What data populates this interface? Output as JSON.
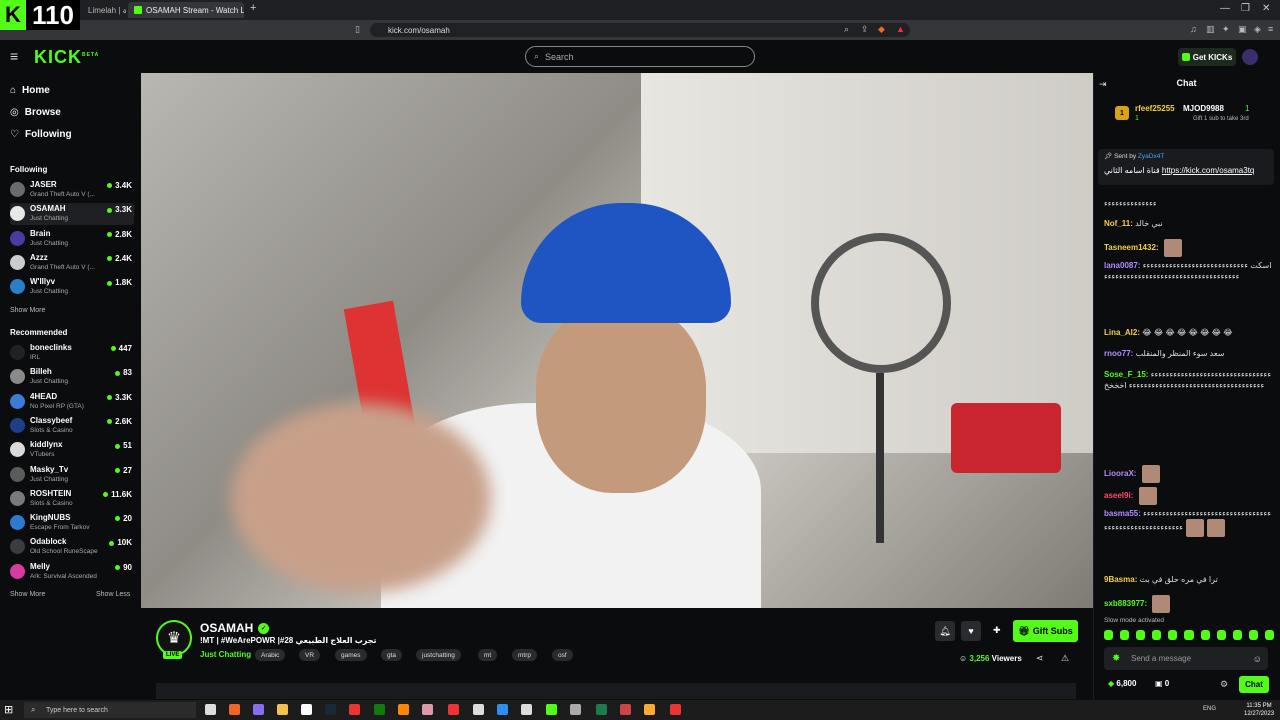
{
  "browser": {
    "counter_badge": "110",
    "tabs": [
      {
        "label": "Limelah | جولة"
      },
      {
        "label": "OSAMAH Stream - Watch Liv"
      }
    ],
    "url": "kick.com/osamah"
  },
  "header": {
    "logo": "KICK",
    "logo_beta": "BETA",
    "search_placeholder": "Search",
    "get_kicks_label": "Get KICKs"
  },
  "sidebar": {
    "nav": [
      {
        "label": "Home",
        "icon": "home-icon"
      },
      {
        "label": "Browse",
        "icon": "compass-icon"
      },
      {
        "label": "Following",
        "icon": "heart-icon"
      }
    ],
    "following_title": "Following",
    "following": [
      {
        "name": "JASER",
        "category": "Grand Theft Auto V (...",
        "viewers": "3.4K",
        "color": "#6b6b6b"
      },
      {
        "name": "OSAMAH",
        "category": "Just Chatting",
        "viewers": "3.3K",
        "color": "#e8e8e8"
      },
      {
        "name": "Brain",
        "category": "Just Chatting",
        "viewers": "2.8K",
        "color": "#4b3aa0"
      },
      {
        "name": "Azzz",
        "category": "Grand Theft Auto V (...",
        "viewers": "2.4K",
        "color": "#cccccc"
      },
      {
        "name": "W'lllyv",
        "category": "Just Chatting",
        "viewers": "1.8K",
        "color": "#2a7fc9"
      }
    ],
    "following_more": "Show More",
    "recommended_title": "Recommended",
    "recommended": [
      {
        "name": "boneclinks",
        "category": "IRL",
        "viewers": "447",
        "color": "#222222"
      },
      {
        "name": "Billeh",
        "category": "Just Chatting",
        "viewers": "83",
        "color": "#8a8a8a"
      },
      {
        "name": "4HEAD",
        "category": "No Pixel RP (GTA)",
        "viewers": "3.3K",
        "color": "#3b7bd6"
      },
      {
        "name": "Classybeef",
        "category": "Slots & Casino",
        "viewers": "2.6K",
        "color": "#1d3f8a"
      },
      {
        "name": "kiddlynx",
        "category": "VTubers",
        "viewers": "51",
        "color": "#d9d9d9"
      },
      {
        "name": "Masky_Tv",
        "category": "Just Chatting",
        "viewers": "27",
        "color": "#5b5b5b"
      },
      {
        "name": "ROSHTEIN",
        "category": "Slots & Casino",
        "viewers": "11.6K",
        "color": "#7a7a7a"
      },
      {
        "name": "KingNUBS",
        "category": "Escape From Tarkov",
        "viewers": "20",
        "color": "#2d7ad1"
      },
      {
        "name": "Odablock",
        "category": "Old School RuneScape",
        "viewers": "10K",
        "color": "#3c3c3c"
      },
      {
        "name": "Melly",
        "category": "Ark: Survival Ascended",
        "viewers": "90",
        "color": "#d63ca0"
      }
    ],
    "recommended_more": "Show More",
    "recommended_less": "Show Less"
  },
  "stream": {
    "channel": "OSAMAH",
    "live_badge": "LIVE",
    "title": "!MT | #WeArePOWR |#28 تجرب العلاج الطبيعي",
    "category": "Just Chatting",
    "tags": [
      "Arabic",
      "VR",
      "games",
      "gta",
      "justchatting",
      "mt",
      "mtrp",
      "osf"
    ],
    "viewers": "3,256",
    "viewers_label": "Viewers",
    "gift_subs_label": "Gift Subs"
  },
  "chat": {
    "title": "Chat",
    "gifters": [
      {
        "rank": "1",
        "name": "rfeef25255",
        "count": "1"
      },
      {
        "name": "MJOD9988",
        "count": "1",
        "note": "Gift 1 sub to take 3rd"
      }
    ],
    "pinned_sent_by": "Sent by",
    "pinned_user": "ZyaDx4T",
    "pinned_text": "قناة اسامه الثاني",
    "pinned_link": "https://kick.com/osama3tq",
    "messages": [
      {
        "user": "",
        "text": "ءءءءءءءءءءءءءء",
        "color": "#ddd"
      },
      {
        "user": "Nof_11:",
        "text": "نبي خالد",
        "color": "#f5d142"
      },
      {
        "user": "Tasneem1432:",
        "text": "",
        "color": "#f5d142",
        "emotes": 1
      },
      {
        "user": "lana0087:",
        "text": "اسكت ءءءءءءءءءءءءءءءءءءءءءءءءءءءءءءءءءءءءءءءءءءءءءءءءءءءءءءءءءءءءءءءء",
        "color": "#b38cff"
      },
      {
        "user": "Lina_AI2:",
        "text": "😂 😂 😂 😂 😂 😂 😂 😂",
        "color": "#f5d142"
      },
      {
        "user": "rnoo77:",
        "text": "سعد سوء المنظر والمنقلب",
        "color": "#b38cff"
      },
      {
        "user": "Sose_F_15:",
        "text": "ءءءءءءءءءءءءءءءءءءءءءءءءءءءءءءءءءءءءءءءءءءءءءءءءءءءءءءءءءءءءءءءءءءءء اخخخخ",
        "color": "#53fc18"
      },
      {
        "user": "LiooraX:",
        "text": "",
        "color": "#b38cff",
        "emotes": 1
      },
      {
        "user": "aseel9i:",
        "text": "",
        "color": "#ff4a6b",
        "emotes": 1
      },
      {
        "user": "basma55:",
        "text": "ءءءءءءءءءءءءءءءءءءءءءءءءءءءءءءءءءءءءءءءءءءءءءءءءءءءءءءء",
        "color": "#b38cff",
        "emotes": 2
      },
      {
        "user": "9Basma:",
        "text": "ترا في مره حلق في بث",
        "color": "#f5d142"
      },
      {
        "user": "sxb883977:",
        "text": "",
        "color": "#53fc18",
        "emotes": 1
      }
    ],
    "slow_mode": "Slow mode activated",
    "input_placeholder": "Send a message",
    "kicks_count": "6,800",
    "subs_count": "0",
    "chat_button": "Chat"
  },
  "taskbar": {
    "search_placeholder": "Type here to search",
    "lang": "ENG",
    "time": "11:35 PM",
    "date": "12/27/2023"
  }
}
